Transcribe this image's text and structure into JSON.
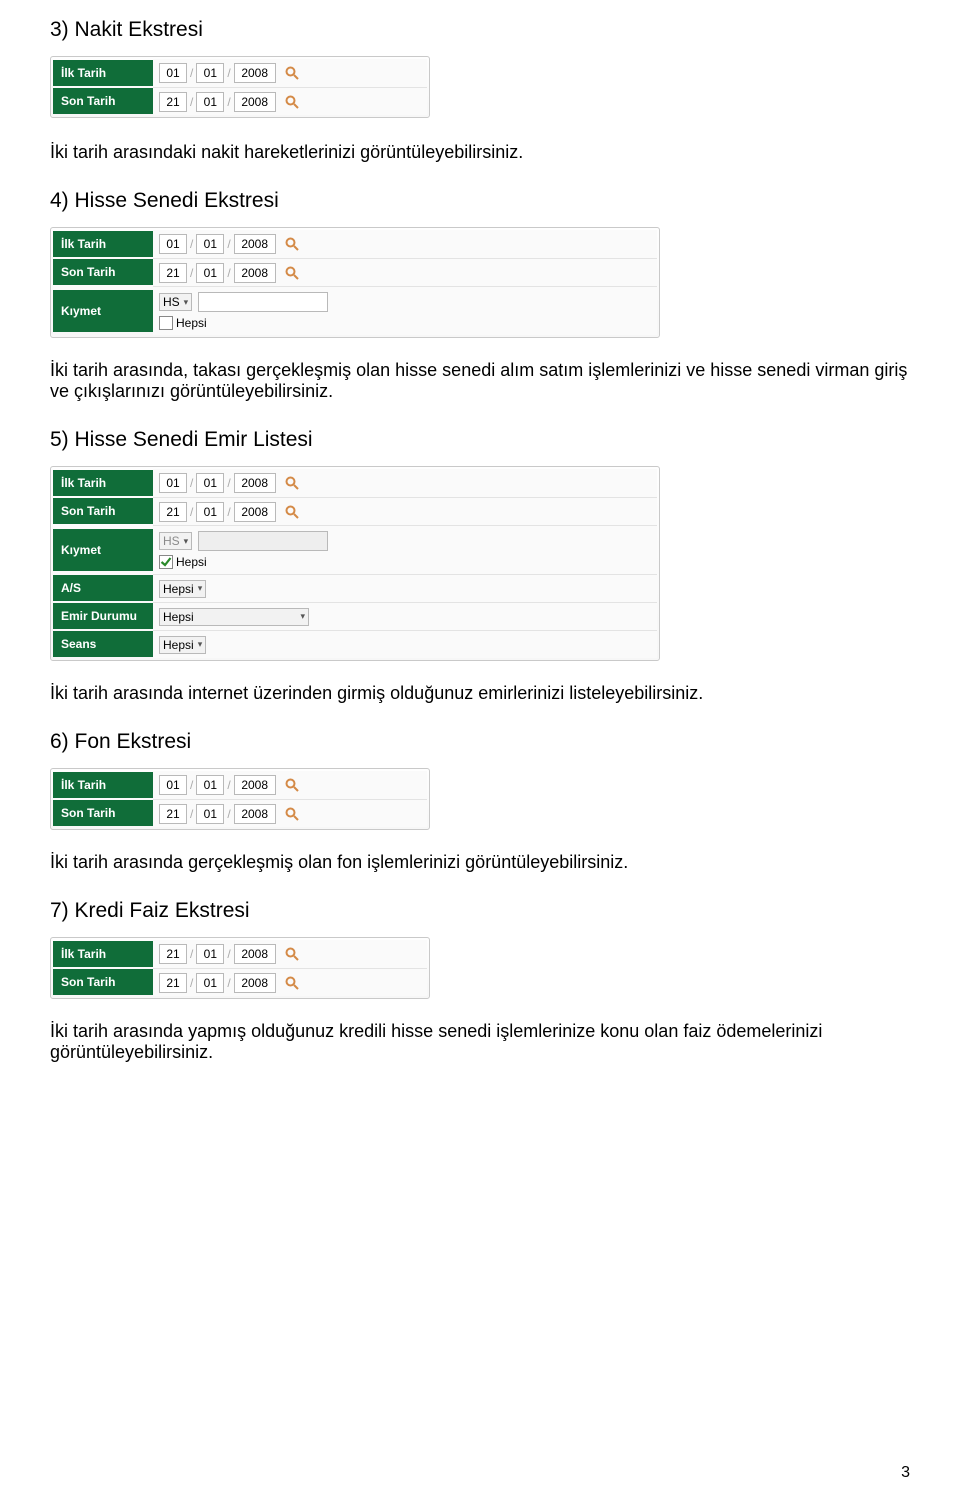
{
  "sections": {
    "s3": {
      "heading": "3)  Nakit Ekstresi",
      "labels": {
        "first": "İlk Tarih",
        "last": "Son Tarih"
      },
      "dates": {
        "first_d": "01",
        "first_m": "01",
        "first_y": "2008",
        "last_d": "21",
        "last_m": "01",
        "last_y": "2008"
      },
      "body": "İki tarih arasındaki nakit hareketlerinizi görüntüleyebilirsiniz."
    },
    "s4": {
      "heading": "4)  Hisse Senedi Ekstresi",
      "labels": {
        "first": "İlk Tarih",
        "last": "Son Tarih",
        "kiymet": "Kıymet"
      },
      "dates": {
        "first_d": "01",
        "first_m": "01",
        "first_y": "2008",
        "last_d": "21",
        "last_m": "01",
        "last_y": "2008"
      },
      "kiymet_select": "HS",
      "kiymet_input": "",
      "hepsi_label": "Hepsi",
      "hepsi_checked": false,
      "body": "İki tarih arasında, takası gerçekleşmiş olan hisse senedi alım satım işlemlerinizi ve hisse  senedi virman giriş ve çıkışlarınızı görüntüleyebilirsiniz."
    },
    "s5": {
      "heading": "5)  Hisse Senedi Emir Listesi",
      "labels": {
        "first": "İlk Tarih",
        "last": "Son Tarih",
        "kiymet": "Kıymet",
        "as": "A/S",
        "emir": "Emir Durumu",
        "seans": "Seans"
      },
      "dates": {
        "first_d": "01",
        "first_m": "01",
        "first_y": "2008",
        "last_d": "21",
        "last_m": "01",
        "last_y": "2008"
      },
      "kiymet_select": "HS",
      "kiymet_input": "",
      "hepsi_label": "Hepsi",
      "hepsi_checked": true,
      "as_select": "Hepsi",
      "emir_select": "Hepsi",
      "seans_select": "Hepsi",
      "body": "İki tarih arasında internet üzerinden girmiş olduğunuz emirlerinizi listeleyebilirsiniz."
    },
    "s6": {
      "heading": "6)  Fon  Ekstresi",
      "labels": {
        "first": "İlk Tarih",
        "last": "Son Tarih"
      },
      "dates": {
        "first_d": "01",
        "first_m": "01",
        "first_y": "2008",
        "last_d": "21",
        "last_m": "01",
        "last_y": "2008"
      },
      "body": "İki tarih arasında gerçekleşmiş olan fon işlemlerinizi görüntüleyebilirsiniz."
    },
    "s7": {
      "heading": "7)  Kredi Faiz Ekstresi",
      "labels": {
        "first": "İlk Tarih",
        "last": "Son Tarih"
      },
      "dates": {
        "first_d": "21",
        "first_m": "01",
        "first_y": "2008",
        "last_d": "21",
        "last_m": "01",
        "last_y": "2008"
      },
      "body": "İki tarih arasında yapmış olduğunuz kredili hisse senedi işlemlerinize konu olan faiz ödemelerinizi görüntüleyebilirsiniz."
    }
  },
  "page_number": "3"
}
